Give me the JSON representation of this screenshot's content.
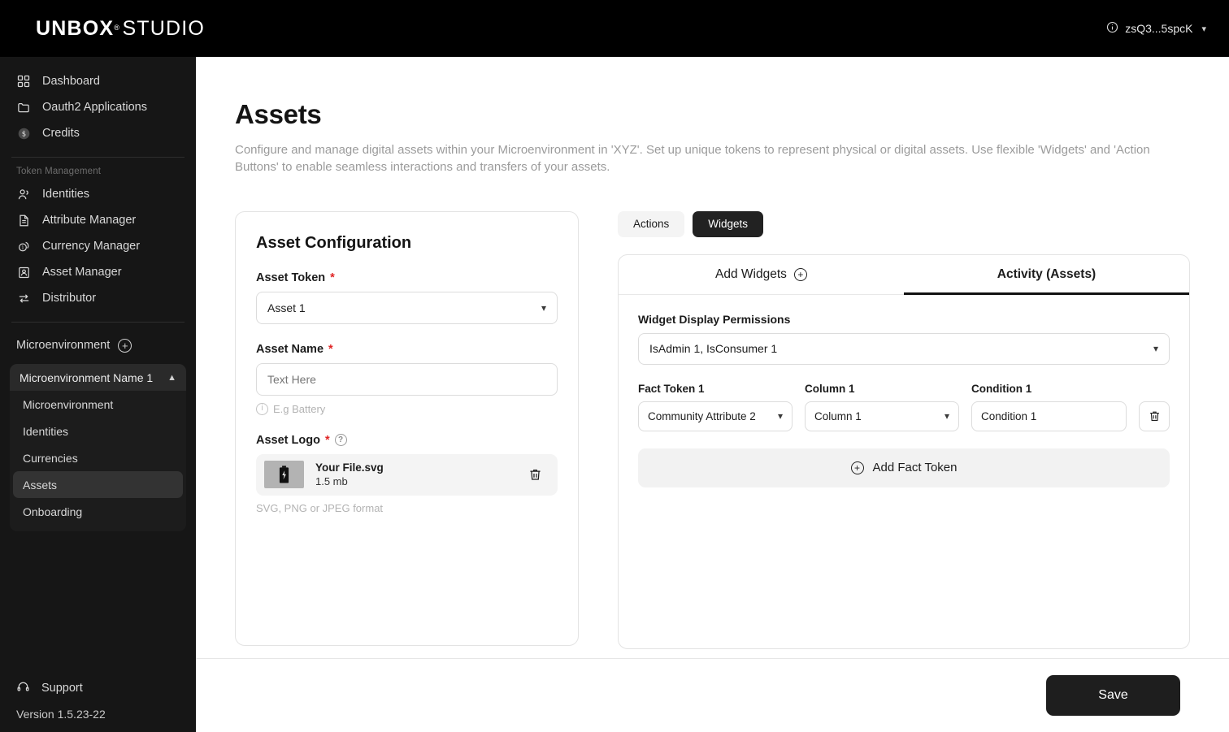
{
  "topbar": {
    "logo_primary": "UNBOX",
    "logo_reg": "®",
    "logo_secondary": "STUDIO",
    "user_label": "zsQ3...5spcK"
  },
  "sidebar": {
    "primary_items": [
      {
        "label": "Dashboard",
        "icon": "grid-icon"
      },
      {
        "label": "Oauth2 Applications",
        "icon": "folder-icon"
      },
      {
        "label": "Credits",
        "icon": "coin-icon"
      }
    ],
    "group_label": "Token Management",
    "token_items": [
      {
        "label": "Identities",
        "icon": "users-icon"
      },
      {
        "label": "Attribute Manager",
        "icon": "document-icon"
      },
      {
        "label": "Currency Manager",
        "icon": "coins-icon"
      },
      {
        "label": "Asset Manager",
        "icon": "asset-icon"
      },
      {
        "label": "Distributor",
        "icon": "transfer-icon"
      }
    ],
    "microenvironment_label": "Microenvironment",
    "microenvironment_group": "Microenvironment Name 1",
    "sub_items": [
      {
        "label": "Microenvironment",
        "active": false
      },
      {
        "label": "Identities",
        "active": false
      },
      {
        "label": "Currencies",
        "active": false
      },
      {
        "label": "Assets",
        "active": true
      },
      {
        "label": "Onboarding",
        "active": false
      }
    ],
    "support_label": "Support",
    "version": "Version 1.5.23-22"
  },
  "page": {
    "title": "Assets",
    "description": "Configure and manage digital assets within your Microenvironment in 'XYZ'. Set up unique tokens to represent physical or digital assets. Use flexible 'Widgets' and 'Action Buttons' to enable seamless interactions and transfers of your assets."
  },
  "asset_config": {
    "title": "Asset Configuration",
    "asset_token": {
      "label": "Asset Token",
      "required": "*",
      "value": "Asset 1"
    },
    "asset_name": {
      "label": "Asset Name",
      "required": "*",
      "value": "",
      "placeholder": "Text Here",
      "hint": "E.g Battery"
    },
    "asset_logo": {
      "label": "Asset Logo",
      "required": "*",
      "file_name": "Your File.svg",
      "file_size": "1.5 mb",
      "format_note": "SVG, PNG or JPEG format"
    }
  },
  "panel": {
    "segmented": [
      {
        "label": "Actions",
        "active": false
      },
      {
        "label": "Widgets",
        "active": true
      }
    ],
    "tabs": [
      {
        "label": "Add Widgets",
        "active": false,
        "icon": "plus-circle-icon"
      },
      {
        "label": "Activity (Assets)",
        "active": true
      }
    ],
    "widget_display_permissions": {
      "label": "Widget Display Permissions",
      "value": "IsAdmin 1, IsConsumer 1"
    },
    "fact_token_row": {
      "fact_token_label": "Fact Token 1",
      "fact_token_value": "Community Attribute 2",
      "column_label": "Column 1",
      "column_value": "Column 1",
      "condition_label": "Condition 1",
      "condition_value": "Condition 1"
    },
    "add_fact_token_label": "Add Fact Token"
  },
  "footer": {
    "save_label": "Save"
  },
  "colors": {
    "sidebar_bg": "#161616",
    "topbar_bg": "#000000",
    "accent_dark": "#1e1e1e",
    "required_red": "#e02424",
    "muted_text": "#9b9b9b"
  }
}
